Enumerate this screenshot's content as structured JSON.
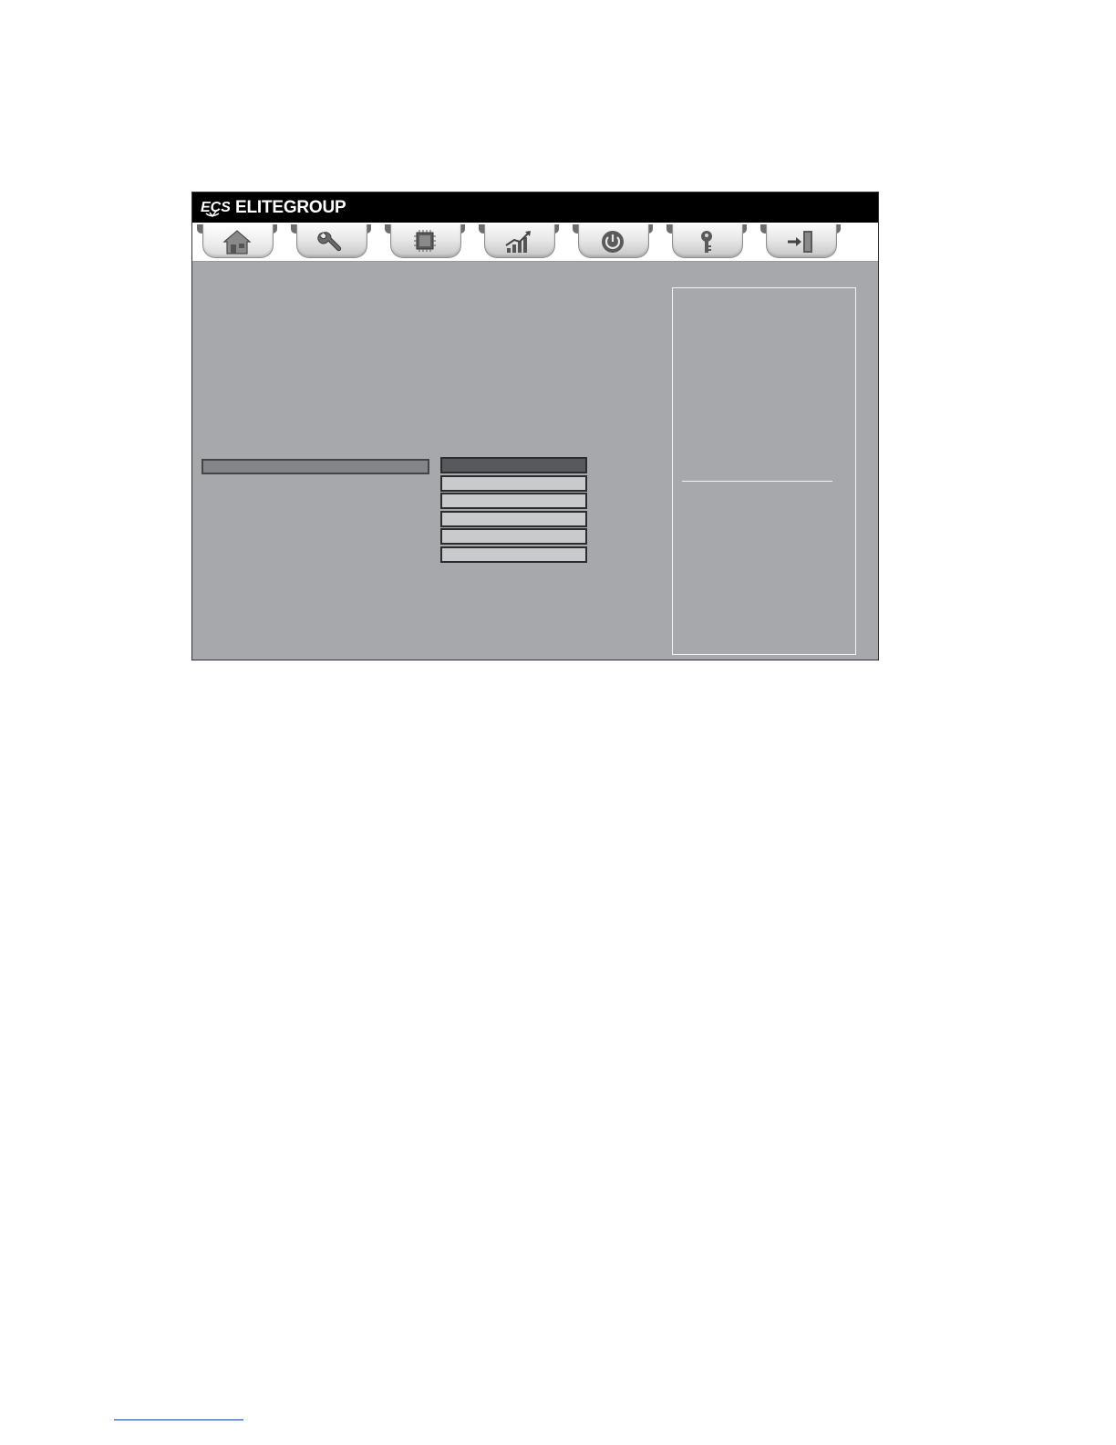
{
  "window": {
    "brand_name": "ELITEGROUP",
    "logo_name": "ECS"
  },
  "tabs": [
    {
      "name": "main",
      "icon": "home-icon",
      "active": true
    },
    {
      "name": "advanced",
      "icon": "wrench-icon",
      "active": false
    },
    {
      "name": "chipset",
      "icon": "chip-icon",
      "active": false
    },
    {
      "name": "mib",
      "icon": "chart-up-icon",
      "active": false
    },
    {
      "name": "boot",
      "icon": "power-icon",
      "active": false
    },
    {
      "name": "security",
      "icon": "key-icon",
      "active": false
    },
    {
      "name": "exit",
      "icon": "exit-door-icon",
      "active": false
    }
  ],
  "popup": {
    "options_count_visible": 6,
    "selected_index": 0
  },
  "colors": {
    "titlebar": "#000000",
    "pane": "#a7a8ab",
    "highlight": "#848589",
    "selected_option": "#58595c",
    "option": "#c9cacc"
  }
}
